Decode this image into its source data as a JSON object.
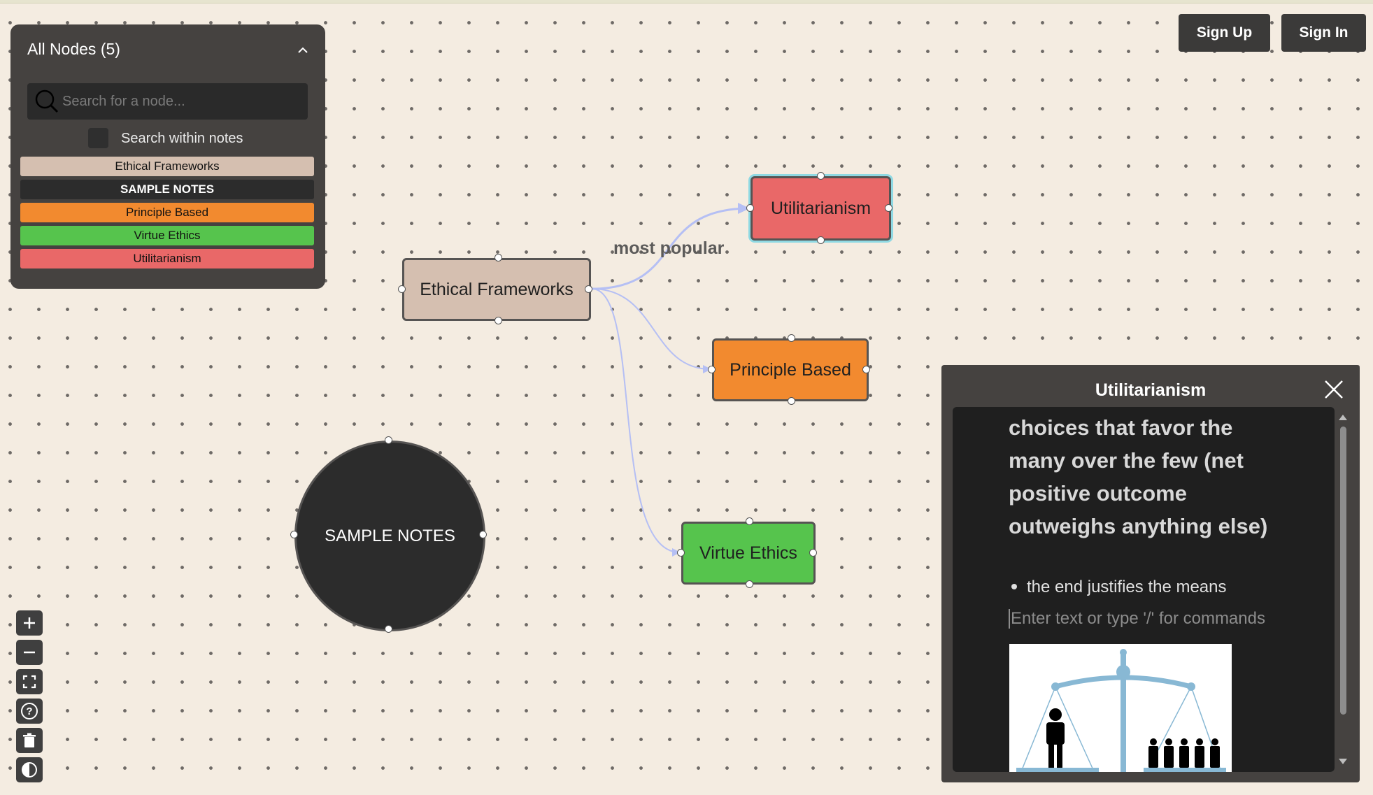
{
  "node_panel": {
    "title": "All Nodes (5)",
    "search_placeholder": "Search for a node...",
    "search_within_label": "Search within notes",
    "chips": [
      {
        "label": "Ethical Frameworks",
        "color": "#d5bfb0",
        "text_color": "#111111",
        "bold": false
      },
      {
        "label": "SAMPLE NOTES",
        "color": "#2c2c2c",
        "text_color": "#ffffff",
        "bold": true
      },
      {
        "label": "Principle Based",
        "color": "#f28a2f",
        "text_color": "#111111",
        "bold": false
      },
      {
        "label": "Virtue Ethics",
        "color": "#56c44d",
        "text_color": "#111111",
        "bold": false
      },
      {
        "label": "Utilitarianism",
        "color": "#e96868",
        "text_color": "#111111",
        "bold": false
      }
    ]
  },
  "auth": {
    "sign_up": "Sign Up",
    "sign_in": "Sign In"
  },
  "graph": {
    "nodes": {
      "ethical_frameworks": {
        "label": "Ethical Frameworks",
        "color": "#d5bfb0"
      },
      "utilitarianism": {
        "label": "Utilitarianism",
        "color": "#e96868",
        "selected": true,
        "selection_color": "#8fd9e3"
      },
      "principle_based": {
        "label": "Principle Based",
        "color": "#f28a2f"
      },
      "virtue_ethics": {
        "label": "Virtue Ethics",
        "color": "#56c44d"
      },
      "sample_notes": {
        "label": "SAMPLE NOTES",
        "color": "#2c2c2c",
        "text_color": "#ffffff"
      }
    },
    "edges": [
      {
        "from": "Ethical Frameworks",
        "to": "Utilitarianism",
        "label": "most popular"
      },
      {
        "from": "Ethical Frameworks",
        "to": "Principle Based",
        "label": ""
      },
      {
        "from": "Ethical Frameworks",
        "to": "Virtue Ethics",
        "label": ""
      }
    ],
    "edge_color": "#b5bff4"
  },
  "controls": [
    "zoom-in-icon",
    "zoom-out-icon",
    "fit-view-icon",
    "help-icon",
    "trash-icon",
    "theme-toggle-icon"
  ],
  "detail": {
    "title": "Utilitarianism",
    "paragraph": "choices that favor the many over the few (net positive outcome outweighs anything else)",
    "bullet": "the end justifies the means",
    "placeholder": "Enter text or type '/' for commands",
    "image_icon": "balance-scale-image"
  }
}
